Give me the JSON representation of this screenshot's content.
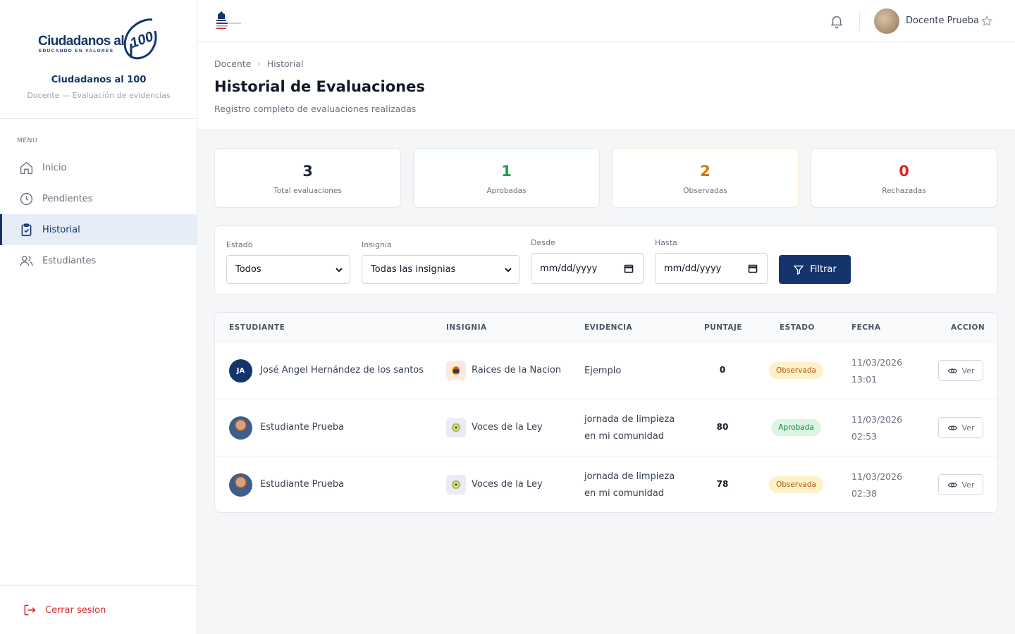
{
  "sidebar": {
    "logo": {
      "line1": "Ciudadanos al",
      "line2": "EDUCANDO EN VALORES",
      "mark": "100"
    },
    "brand_name": "Ciudadanos al 100",
    "brand_role": "Docente — Evaluación de evidencias",
    "menu_title": "MENU",
    "items": [
      {
        "label": "Inicio",
        "icon": "home-icon",
        "active": false
      },
      {
        "label": "Pendientes",
        "icon": "clock-icon",
        "active": false
      },
      {
        "label": "Historial",
        "icon": "clipboard-check-icon",
        "active": true
      },
      {
        "label": "Estudiantes",
        "icon": "users-icon",
        "active": false
      }
    ],
    "logout_label": "Cerrar sesion"
  },
  "topbar": {
    "user_name": "Docente Prueba",
    "icons": [
      "gov-logo-icon",
      "bell-icon",
      "avatar",
      "star-icon"
    ]
  },
  "page": {
    "breadcrumb": [
      "Docente",
      "Historial"
    ],
    "title": "Historial de Evaluaciones",
    "subtitle": "Registro completo de evaluaciones realizadas"
  },
  "stats": [
    {
      "value": "3",
      "label": "Total evaluaciones",
      "color": "#1e293b"
    },
    {
      "value": "1",
      "label": "Aprobadas",
      "color": "#16a34a"
    },
    {
      "value": "2",
      "label": "Observadas",
      "color": "#d97706"
    },
    {
      "value": "0",
      "label": "Rechazadas",
      "color": "#dc2626"
    }
  ],
  "filters": {
    "estado": {
      "label": "Estado",
      "value": "Todos"
    },
    "insignia": {
      "label": "Insignia",
      "value": "Todas las insignias"
    },
    "desde": {
      "label": "Desde",
      "placeholder": "mm/dd/yyyy"
    },
    "hasta": {
      "label": "Hasta",
      "placeholder": "mm/dd/yyyy"
    },
    "button_label": "Filtrar"
  },
  "table": {
    "headers": [
      "ESTUDIANTE",
      "INSIGNIA",
      "EVIDENCIA",
      "PUNTAJE",
      "ESTADO",
      "FECHA",
      "ACCION"
    ],
    "rows": [
      {
        "initials": "JA",
        "student": "José Angel Hernández de los santos",
        "badge": "Raices de la Nacion",
        "evidence_1": "Ejemplo",
        "evidence_2": "",
        "score": "0",
        "status": "Observada",
        "date": "11/03/2026",
        "time": "13:01",
        "action": "Ver"
      },
      {
        "initials": "",
        "student": "Estudiante Prueba",
        "badge": "Voces de la Ley",
        "evidence_1": "jornada de limpieza",
        "evidence_2": "en mi comunidad",
        "score": "80",
        "status": "Aprobada",
        "date": "11/03/2026",
        "time": "02:53",
        "action": "Ver"
      },
      {
        "initials": "",
        "student": "Estudiante Prueba",
        "badge": "Voces de la Ley",
        "evidence_1": "jornada de limpieza",
        "evidence_2": "en mi comunidad",
        "score": "78",
        "status": "Observada",
        "date": "11/03/2026",
        "time": "02:38",
        "action": "Ver"
      }
    ]
  }
}
